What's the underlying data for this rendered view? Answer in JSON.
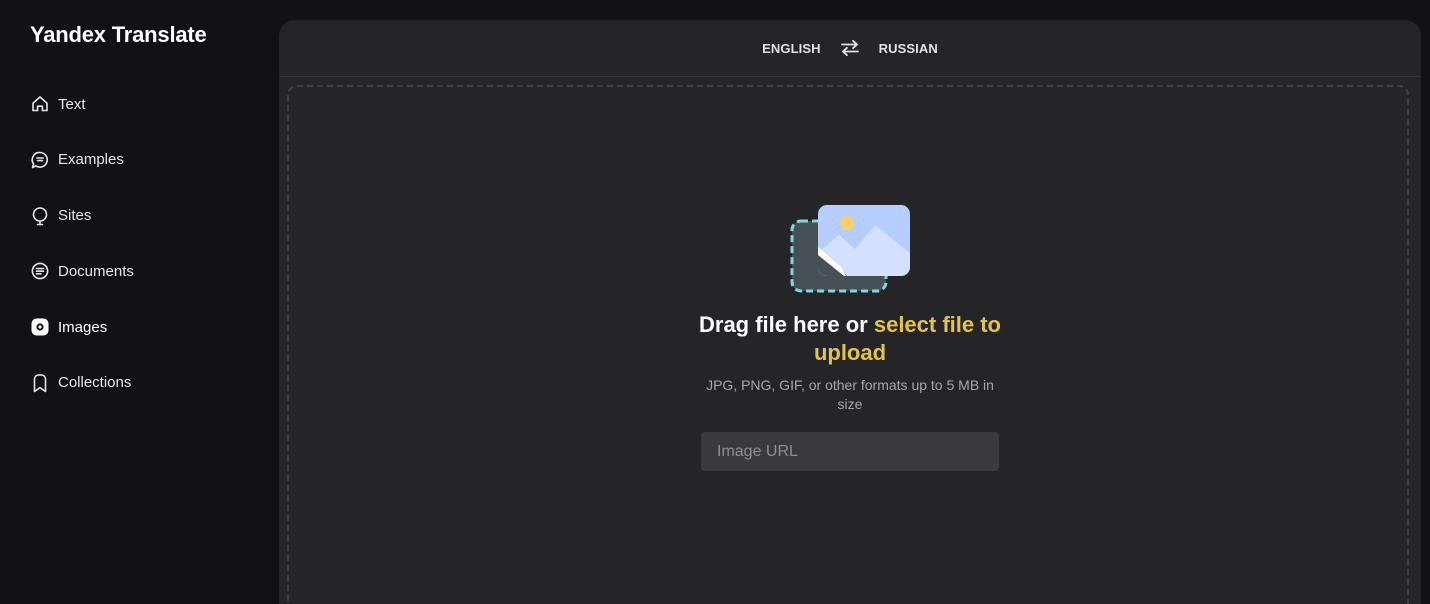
{
  "app": {
    "title": "Yandex Translate"
  },
  "sidebar": {
    "items": [
      {
        "label": "Text",
        "icon": "home-icon",
        "active": false
      },
      {
        "label": "Examples",
        "icon": "chat-bubble-icon",
        "active": false
      },
      {
        "label": "Sites",
        "icon": "globe-pin-icon",
        "active": false
      },
      {
        "label": "Documents",
        "icon": "document-icon",
        "active": false
      },
      {
        "label": "Images",
        "icon": "image-lens-icon",
        "active": true
      },
      {
        "label": "Collections",
        "icon": "bookmark-icon",
        "active": false
      }
    ]
  },
  "language_bar": {
    "source": "ENGLISH",
    "target": "RUSSIAN",
    "swap_icon": "swap-arrows-icon"
  },
  "upload": {
    "title_prefix": "Drag file here or ",
    "title_link": "select file to upload",
    "hint": "JPG, PNG, GIF, or other formats up to 5 MB in size",
    "url_placeholder": "Image URL",
    "url_value": ""
  },
  "colors": {
    "background": "#121214",
    "panel": "#252528",
    "accent_link": "#e3c24d",
    "input_bg": "#3a3a3e"
  }
}
